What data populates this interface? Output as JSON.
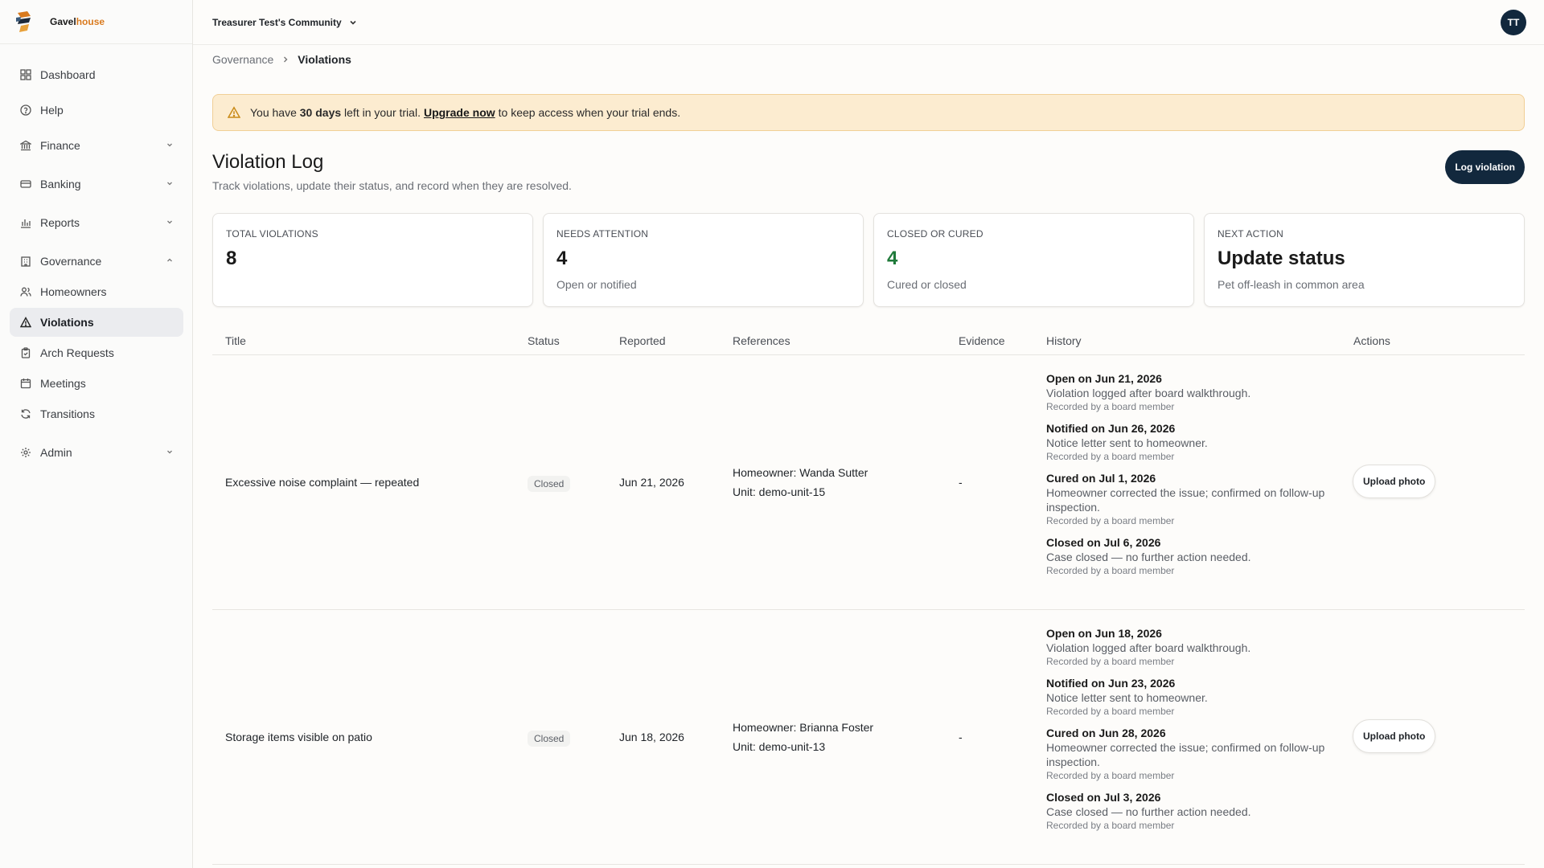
{
  "app": {
    "logo_part1": "Gavel",
    "logo_part2": "house",
    "brand_color": "#d97a1e",
    "primary_color": "#12283d"
  },
  "sidebar": {
    "items": [
      {
        "label": "Dashboard",
        "icon": "grid-icon"
      },
      {
        "label": "Help",
        "icon": "help-circle-icon"
      },
      {
        "label": "Finance",
        "icon": "bank-icon",
        "expandable": true
      },
      {
        "label": "Banking",
        "icon": "card-icon",
        "expandable": true
      },
      {
        "label": "Reports",
        "icon": "bar-chart-icon",
        "expandable": true
      },
      {
        "label": "Governance",
        "icon": "building-icon",
        "expandable": true,
        "expanded": true
      },
      {
        "label": "Homeowners",
        "icon": "users-icon"
      },
      {
        "label": "Violations",
        "icon": "warning-icon",
        "active": true
      },
      {
        "label": "Arch Requests",
        "icon": "clipboard-icon"
      },
      {
        "label": "Meetings",
        "icon": "calendar-icon"
      },
      {
        "label": "Transitions",
        "icon": "refresh-icon"
      },
      {
        "label": "Admin",
        "icon": "gear-icon",
        "expandable": true
      }
    ]
  },
  "header": {
    "community": "Treasurer Test's Community",
    "avatar_initials": "TT"
  },
  "breadcrumb": {
    "parent": "Governance",
    "current": "Violations"
  },
  "banner": {
    "prefix": "You have",
    "days": "30 days",
    "middle": "left in your trial.",
    "link": "Upgrade now",
    "suffix": "to keep access when your trial ends."
  },
  "page": {
    "title": "Violation Log",
    "subtitle": "Track violations, update their status, and record when they are resolved.",
    "primary_button": "Log violation"
  },
  "stats": [
    {
      "label": "TOTAL VIOLATIONS",
      "value": "8",
      "note": ""
    },
    {
      "label": "NEEDS ATTENTION",
      "value": "4",
      "note": "Open or notified"
    },
    {
      "label": "CLOSED OR CURED",
      "value": "4",
      "note": "Cured or closed"
    },
    {
      "label": "NEXT ACTION",
      "value": "Update status",
      "note": "Pet off-leash in common area"
    }
  ],
  "table": {
    "columns": [
      "Title",
      "Status",
      "Reported",
      "References",
      "Evidence",
      "History",
      "Actions"
    ],
    "rows": [
      {
        "title": "Excessive noise complaint — repeated",
        "status": "Closed",
        "reported": "Jun 21, 2026",
        "homeowner": "Homeowner: Wanda Sutter",
        "unit": "Unit: demo-unit-15",
        "evidence": "-",
        "action": "Upload photo",
        "history": [
          {
            "title": "Open on Jun 21, 2026",
            "desc": "Violation logged after board walkthrough.",
            "by": "Recorded by a board member"
          },
          {
            "title": "Notified on Jun 26, 2026",
            "desc": "Notice letter sent to homeowner.",
            "by": "Recorded by a board member"
          },
          {
            "title": "Cured on Jul 1, 2026",
            "desc": "Homeowner corrected the issue; confirmed on follow-up inspection.",
            "by": "Recorded by a board member"
          },
          {
            "title": "Closed on Jul 6, 2026",
            "desc": "Case closed — no further action needed.",
            "by": "Recorded by a board member"
          }
        ]
      },
      {
        "title": "Storage items visible on patio",
        "status": "Closed",
        "reported": "Jun 18, 2026",
        "homeowner": "Homeowner: Brianna Foster",
        "unit": "Unit: demo-unit-13",
        "evidence": "-",
        "action": "Upload photo",
        "history": [
          {
            "title": "Open on Jun 18, 2026",
            "desc": "Violation logged after board walkthrough.",
            "by": "Recorded by a board member"
          },
          {
            "title": "Notified on Jun 23, 2026",
            "desc": "Notice letter sent to homeowner.",
            "by": "Recorded by a board member"
          },
          {
            "title": "Cured on Jun 28, 2026",
            "desc": "Homeowner corrected the issue; confirmed on follow-up inspection.",
            "by": "Recorded by a board member"
          },
          {
            "title": "Closed on Jul 3, 2026",
            "desc": "Case closed — no further action needed.",
            "by": "Recorded by a board member"
          }
        ]
      }
    ]
  }
}
